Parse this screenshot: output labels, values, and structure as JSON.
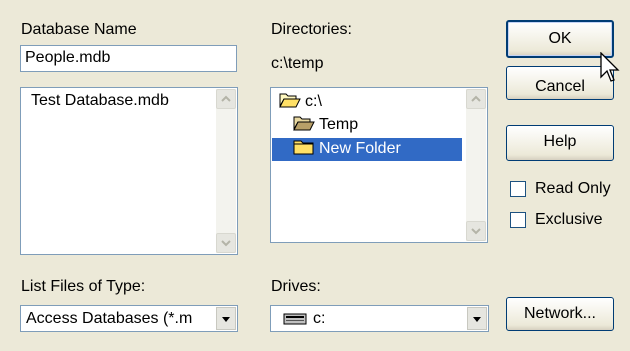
{
  "database_name": {
    "label": "Database Name",
    "value": "People.mdb"
  },
  "files_list": {
    "items": [
      "Test Database.mdb"
    ]
  },
  "directories": {
    "label": "Directories:",
    "current_path": "c:\\temp",
    "tree": [
      {
        "label": "c:\\",
        "icon": "open-folder-icon"
      },
      {
        "label": "Temp",
        "icon": "open-folder-icon"
      },
      {
        "label": "New Folder",
        "icon": "folder-icon",
        "selected": true
      }
    ]
  },
  "file_type": {
    "label": "List Files of Type:",
    "value": "Access Databases (*.m"
  },
  "drives": {
    "label": "Drives:",
    "value": "c:",
    "icon": "drive-icon"
  },
  "buttons": {
    "ok": "OK",
    "cancel": "Cancel",
    "help": "Help",
    "network": "Network..."
  },
  "options": {
    "read_only": "Read Only",
    "exclusive": "Exclusive"
  },
  "colors": {
    "dialog_bg": "#ece9d8",
    "selection": "#316ac5",
    "field_border": "#7f9db9",
    "default_button_border": "#003c74"
  }
}
